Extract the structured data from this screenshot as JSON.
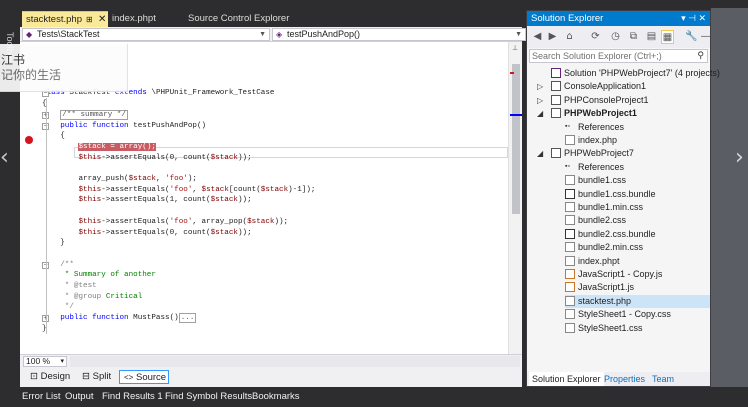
{
  "tabs": [
    {
      "label": "stacktest.php",
      "pin": "⊞",
      "close": "✕",
      "active": true
    },
    {
      "label": "index.phpt",
      "active": false
    },
    {
      "label": "Source Control Explorer",
      "active": false
    }
  ],
  "left_panel": {
    "toolbox_label": "Toolbox"
  },
  "navbar": {
    "class_selector": "Tests\\StackTest",
    "method_selector": "testPushAndPop()"
  },
  "overlay": {
    "line1": "江书",
    "line2": "记你的生活"
  },
  "code_lines": [
    {
      "parts": []
    },
    {
      "parts": []
    },
    {
      "parts": [
        {
          "cls": "k",
          "text": "class "
        },
        {
          "cls": "t",
          "text": "StackTest "
        },
        {
          "cls": "k",
          "text": "extends "
        },
        {
          "cls": "t",
          "text": "\\PHPUnit_Framework_TestCase"
        }
      ]
    },
    {
      "parts": [
        {
          "cls": "t",
          "text": "{"
        }
      ]
    },
    {
      "parts": [
        {
          "cls": "t",
          "text": "    "
        },
        {
          "cls": "collapsed g",
          "text": "/** summary */"
        }
      ]
    },
    {
      "parts": [
        {
          "cls": "k",
          "text": "    public function "
        },
        {
          "cls": "t",
          "text": "testPushAndPop()"
        }
      ]
    },
    {
      "parts": [
        {
          "cls": "t",
          "text": "    {"
        }
      ]
    },
    {
      "parts": [
        {
          "cls": "t",
          "text": "        "
        },
        {
          "cls": "hl",
          "text": "$stack = array();"
        }
      ]
    },
    {
      "parts": [
        {
          "cls": "v",
          "text": "        $this"
        },
        {
          "cls": "t",
          "text": "->assertEquals(0, count("
        },
        {
          "cls": "v",
          "text": "$stack"
        },
        {
          "cls": "t",
          "text": "));"
        }
      ]
    },
    {
      "parts": []
    },
    {
      "parts": [
        {
          "cls": "t",
          "text": "        array_push("
        },
        {
          "cls": "v",
          "text": "$stack"
        },
        {
          "cls": "t",
          "text": ", "
        },
        {
          "cls": "s",
          "text": "'foo'"
        },
        {
          "cls": "t",
          "text": ");"
        }
      ]
    },
    {
      "parts": [
        {
          "cls": "v",
          "text": "        $this"
        },
        {
          "cls": "t",
          "text": "->assertEquals("
        },
        {
          "cls": "s",
          "text": "'foo'"
        },
        {
          "cls": "t",
          "text": ", "
        },
        {
          "cls": "v",
          "text": "$stack"
        },
        {
          "cls": "t",
          "text": "[count("
        },
        {
          "cls": "v",
          "text": "$stack"
        },
        {
          "cls": "t",
          "text": ")-1]);"
        }
      ]
    },
    {
      "parts": [
        {
          "cls": "v",
          "text": "        $this"
        },
        {
          "cls": "t",
          "text": "->assertEquals(1, count("
        },
        {
          "cls": "v",
          "text": "$stack"
        },
        {
          "cls": "t",
          "text": "));"
        }
      ]
    },
    {
      "parts": []
    },
    {
      "parts": [
        {
          "cls": "v",
          "text": "        $this"
        },
        {
          "cls": "t",
          "text": "->assertEquals("
        },
        {
          "cls": "s",
          "text": "'foo'"
        },
        {
          "cls": "t",
          "text": ", array_pop("
        },
        {
          "cls": "v",
          "text": "$stack"
        },
        {
          "cls": "t",
          "text": "));"
        }
      ]
    },
    {
      "parts": [
        {
          "cls": "v",
          "text": "        $this"
        },
        {
          "cls": "t",
          "text": "->assertEquals(0, count("
        },
        {
          "cls": "v",
          "text": "$stack"
        },
        {
          "cls": "t",
          "text": "));"
        }
      ]
    },
    {
      "parts": [
        {
          "cls": "t",
          "text": "    }"
        }
      ]
    },
    {
      "parts": []
    },
    {
      "parts": [
        {
          "cls": "g",
          "text": "    /**"
        }
      ]
    },
    {
      "parts": [
        {
          "cls": "c",
          "text": "     * Summary of another"
        }
      ]
    },
    {
      "parts": [
        {
          "cls": "g",
          "text": "     * @test"
        }
      ]
    },
    {
      "parts": [
        {
          "cls": "g",
          "text": "     * @group "
        },
        {
          "cls": "c",
          "text": "Critical"
        }
      ]
    },
    {
      "parts": [
        {
          "cls": "g",
          "text": "     */"
        }
      ]
    },
    {
      "parts": [
        {
          "cls": "k",
          "text": "    public function "
        },
        {
          "cls": "t",
          "text": "MustPass()"
        },
        {
          "cls": "collapsed",
          "text": "..."
        }
      ]
    },
    {
      "parts": [
        {
          "cls": "t",
          "text": "}"
        }
      ]
    }
  ],
  "editor_status": {
    "zoom": "100 %",
    "zoom_arrow": "▾"
  },
  "view_tabs": [
    {
      "icon": "⊡",
      "label": "Design"
    },
    {
      "icon": "⊟",
      "label": "Split"
    },
    {
      "icon": "<>",
      "label": "Source",
      "selected": true
    }
  ],
  "solution_explorer": {
    "title": "Solution Explorer",
    "title_controls": "▾ ⊣ ✕",
    "search_placeholder": "Search Solution Explorer (Ctrl+;)",
    "search_icon": "⚲",
    "toolbar_icons": [
      "back-icon",
      "forward-icon",
      "home-icon",
      "sync-icon",
      "history-icon",
      "collapse-icon",
      "copy-icon",
      "show-all-icon",
      "properties-icon",
      "pin-icon"
    ],
    "toolbar_glyphs": [
      "◀",
      "▶",
      "⌂",
      "⟳",
      "◷",
      "⧉",
      "▤",
      "▦",
      "🔧",
      "—"
    ],
    "tree": [
      {
        "label": "Solution 'PHPWebProject7' (4 projects)",
        "indent": 0,
        "icon": "sol",
        "arrow": ""
      },
      {
        "label": "ConsoleApplication1",
        "indent": 0,
        "icon": "proj",
        "arrow": "▷"
      },
      {
        "label": "PHPConsoleProject1",
        "indent": 0,
        "icon": "proj",
        "arrow": "▷"
      },
      {
        "label": "PHPWebProject1",
        "indent": 0,
        "icon": "proj",
        "arrow": "◢",
        "bold": true
      },
      {
        "label": "References",
        "indent": 1,
        "icon": "ref",
        "arrow": ""
      },
      {
        "label": "index.php",
        "indent": 1,
        "icon": "php",
        "arrow": ""
      },
      {
        "label": "PHPWebProject7",
        "indent": 0,
        "icon": "proj",
        "arrow": "◢"
      },
      {
        "label": "References",
        "indent": 1,
        "icon": "ref",
        "arrow": ""
      },
      {
        "label": "bundle1.css",
        "indent": 1,
        "icon": "css",
        "arrow": ""
      },
      {
        "label": "bundle1.css.bundle",
        "indent": 1,
        "icon": "bundle",
        "arrow": ""
      },
      {
        "label": "bundle1.min.css",
        "indent": 1,
        "icon": "css",
        "arrow": ""
      },
      {
        "label": "bundle2.css",
        "indent": 1,
        "icon": "css",
        "arrow": ""
      },
      {
        "label": "bundle2.css.bundle",
        "indent": 1,
        "icon": "bundle",
        "arrow": ""
      },
      {
        "label": "bundle2.min.css",
        "indent": 1,
        "icon": "css",
        "arrow": ""
      },
      {
        "label": "index.phpt",
        "indent": 1,
        "icon": "php",
        "arrow": ""
      },
      {
        "label": "JavaScript1 - Copy.js",
        "indent": 1,
        "icon": "js",
        "arrow": ""
      },
      {
        "label": "JavaScript1.js",
        "indent": 1,
        "icon": "js",
        "arrow": ""
      },
      {
        "label": "stacktest.php",
        "indent": 1,
        "icon": "php",
        "arrow": "",
        "selected": true
      },
      {
        "label": "StyleSheet1 - Copy.css",
        "indent": 1,
        "icon": "css",
        "arrow": ""
      },
      {
        "label": "StyleSheet1.css",
        "indent": 1,
        "icon": "css",
        "arrow": ""
      }
    ],
    "bottom_tabs": [
      {
        "label": "Solution Explorer",
        "selected": true
      },
      {
        "label": "Properties"
      },
      {
        "label": "Team Explorer"
      }
    ]
  },
  "status_bar": [
    "Error List",
    "Output",
    "Find Results 1",
    "Find Symbol Results",
    "Bookmarks"
  ],
  "carousel": {
    "prev": "‹",
    "next": "›"
  },
  "colors": {
    "accent": "#007acc",
    "active_tab": "#fbe99a",
    "breakpoint": "#d5141f",
    "breakpoint_line": "#c95c62"
  }
}
